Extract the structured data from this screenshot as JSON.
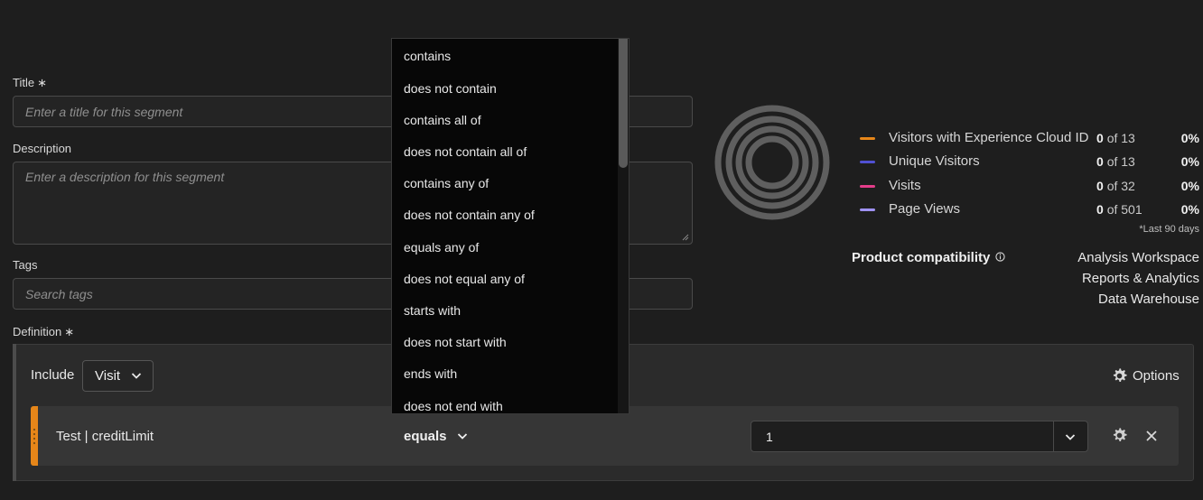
{
  "form": {
    "title_label": "Title",
    "title_required": "∗",
    "title_placeholder": "Enter a title for this segment",
    "description_label": "Description",
    "description_placeholder": "Enter a description for this segment",
    "tags_label": "Tags",
    "tags_placeholder": "Search tags",
    "definition_label": "Definition",
    "definition_required": "∗"
  },
  "definition": {
    "include_label": "Include",
    "scope_value": "Visit",
    "options_label": "Options",
    "rule": {
      "dimension": "Test | creditLimit",
      "operator": "equals",
      "value": "1"
    }
  },
  "operator_options": [
    "contains",
    "does not contain",
    "contains all of",
    "does not contain all of",
    "contains any of",
    "does not contain any of",
    "equals any of",
    "does not equal any of",
    "starts with",
    "does not start with",
    "ends with",
    "does not end with"
  ],
  "summary": {
    "metrics": [
      {
        "name": "Visitors with Experience Cloud ID",
        "count": "0",
        "of": "of 13",
        "pct": "0%",
        "color": "#e68619"
      },
      {
        "name": "Unique Visitors",
        "count": "0",
        "of": "of 13",
        "pct": "0%",
        "color": "#5151d3"
      },
      {
        "name": "Visits",
        "count": "0",
        "of": "of 32",
        "pct": "0%",
        "color": "#e43d8a"
      },
      {
        "name": "Page Views",
        "count": "0",
        "of": "of 501",
        "pct": "0%",
        "color": "#9f92f2"
      }
    ],
    "footnote": "*Last 90 days",
    "compat_label": "Product compatibility",
    "compat_items": [
      "Analysis Workspace",
      "Reports & Analytics",
      "Data Warehouse"
    ]
  }
}
